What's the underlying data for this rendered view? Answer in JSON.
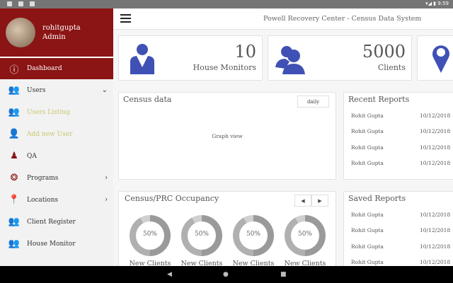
{
  "status_bar": {
    "time": "9:59"
  },
  "sidebar": {
    "username": "rohitgupta",
    "role": "Admin",
    "items": [
      {
        "label": "Dashboard",
        "icon": "dashboard-icon"
      },
      {
        "label": "Users",
        "icon": "users-icon"
      },
      {
        "label": "Users Listing",
        "icon": "users-listing-icon"
      },
      {
        "label": "Add new User",
        "icon": "add-user-icon"
      },
      {
        "label": "QA",
        "icon": "qa-icon"
      },
      {
        "label": "Programs",
        "icon": "programs-icon"
      },
      {
        "label": "Locations",
        "icon": "location-icon"
      },
      {
        "label": "Client Register",
        "icon": "client-register-icon"
      },
      {
        "label": "House Monitor",
        "icon": "house-monitor-icon"
      }
    ]
  },
  "header": {
    "title": "Powell Recovery Center - Census Data System"
  },
  "stats": [
    {
      "value": "10",
      "label": "House Monitors"
    },
    {
      "value": "5000",
      "label": "Clients"
    }
  ],
  "census": {
    "title": "Census data",
    "period": "daily",
    "placeholder": "Graph view"
  },
  "recent_reports": {
    "title": "Recent Reports",
    "rows": [
      {
        "name": "Rohit Gupta",
        "date": "10/12/2018"
      },
      {
        "name": "Rohit Gupta",
        "date": "10/12/2018"
      },
      {
        "name": "Rohit Gupta",
        "date": "10/12/2018"
      },
      {
        "name": "Rohit Gupta",
        "date": "10/12/2018"
      }
    ]
  },
  "occupancy": {
    "title": "Census/PRC Occupancy",
    "prev": "◀",
    "next": "▶",
    "items": [
      {
        "percent": "50%",
        "label": "New Clients"
      },
      {
        "percent": "50%",
        "label": "New Clients"
      },
      {
        "percent": "50%",
        "label": "New Clients"
      },
      {
        "percent": "50%",
        "label": "New Clients"
      }
    ]
  },
  "saved_reports": {
    "title": "Saved Reports",
    "rows": [
      {
        "name": "Rohit Gupta",
        "date": "10/12/2018"
      },
      {
        "name": "Rohit Gupta",
        "date": "10/12/2018"
      },
      {
        "name": "Rohit Gupta",
        "date": "10/12/2018"
      },
      {
        "name": "Rohit Gupta",
        "date": "10/12/2018"
      }
    ]
  },
  "colors": {
    "brand": "#8b1414",
    "stat_icon": "#3f51b5"
  }
}
